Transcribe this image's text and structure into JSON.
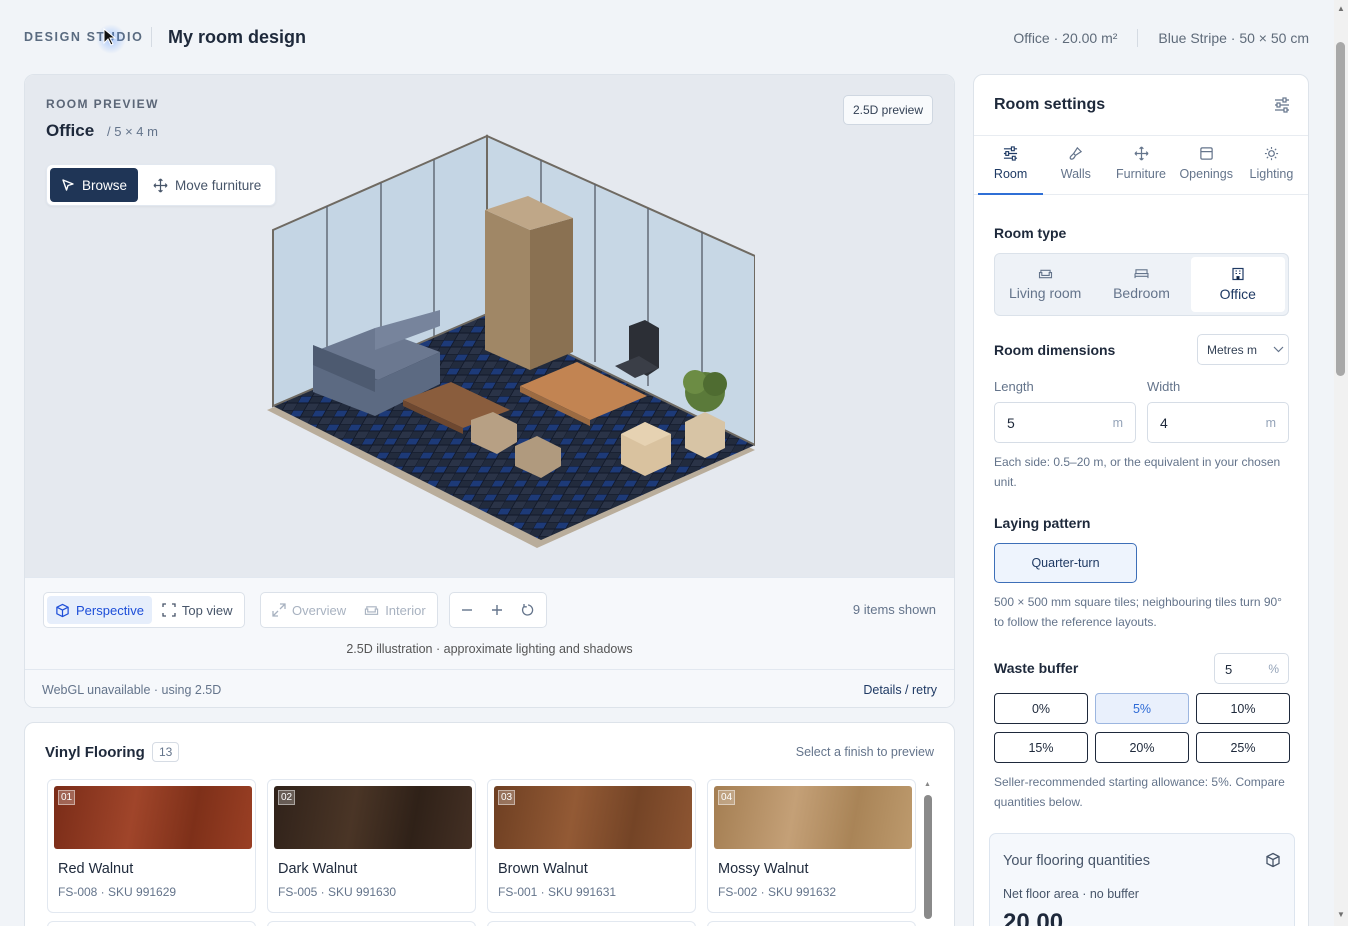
{
  "header": {
    "brand": "DESIGN STUDIO",
    "title": "My room design",
    "room_meta": "Office · 20.00 m²",
    "tile_meta": "Blue Stripe · 50 × 50 cm"
  },
  "preview": {
    "section_label": "ROOM PREVIEW",
    "room_name": "Office",
    "room_dims": "/ 5 × 4 m",
    "mode_badge": "2.5D preview",
    "modes": {
      "browse": "Browse",
      "move": "Move furniture"
    },
    "views": {
      "perspective": "Perspective",
      "top": "Top view",
      "overview": "Overview",
      "interior": "Interior"
    },
    "items_shown": "9 items shown",
    "note": "2.5D illustration · approximate lighting and shadows",
    "status": "WebGL unavailable · using 2.5D",
    "details_link": "Details / retry"
  },
  "flooring": {
    "title": "Vinyl Flooring",
    "count": "13",
    "hint": "Select a finish to preview",
    "items": [
      {
        "num": "01",
        "name": "Red Walnut",
        "sku": "FS-008 · SKU 991629",
        "color": "#8a3520"
      },
      {
        "num": "02",
        "name": "Dark Walnut",
        "sku": "FS-005 · SKU 991630",
        "color": "#3c2a1e"
      },
      {
        "num": "03",
        "name": "Brown Walnut",
        "sku": "FS-001 · SKU 991631",
        "color": "#7e4a2b"
      },
      {
        "num": "04",
        "name": "Mossy Walnut",
        "sku": "FS-002 · SKU 991632",
        "color": "#b48d5e"
      }
    ]
  },
  "settings": {
    "title": "Room settings",
    "tabs": [
      "Room",
      "Walls",
      "Furniture",
      "Openings",
      "Lighting"
    ],
    "room_type_label": "Room type",
    "room_types": [
      "Living room",
      "Bedroom",
      "Office"
    ],
    "dims_label": "Room dimensions",
    "unit": "Metres m",
    "length_label": "Length",
    "length_value": "5",
    "width_label": "Width",
    "width_value": "4",
    "unit_suffix": "m",
    "dims_help": "Each side: 0.5–20 m, or the equivalent in your chosen unit.",
    "pattern_label": "Laying pattern",
    "pattern_value": "Quarter-turn",
    "pattern_help": "500 × 500 mm square tiles; neighbouring tiles turn 90° to follow the reference layouts.",
    "waste_label": "Waste buffer",
    "waste_value": "5",
    "waste_unit": "%",
    "waste_options": [
      "0%",
      "5%",
      "10%",
      "15%",
      "20%",
      "25%"
    ],
    "waste_help": "Seller-recommended starting allowance: 5%. Compare quantities below.",
    "qty_title": "Your flooring quantities",
    "qty_label": "Net floor area · no buffer",
    "qty_value": "20.00"
  },
  "colors": {
    "accent": "#1f3556",
    "link": "#2f6fd6",
    "floor_tile_dark": "#1f2a3f",
    "floor_tile_blue": "#1b3f8a"
  }
}
